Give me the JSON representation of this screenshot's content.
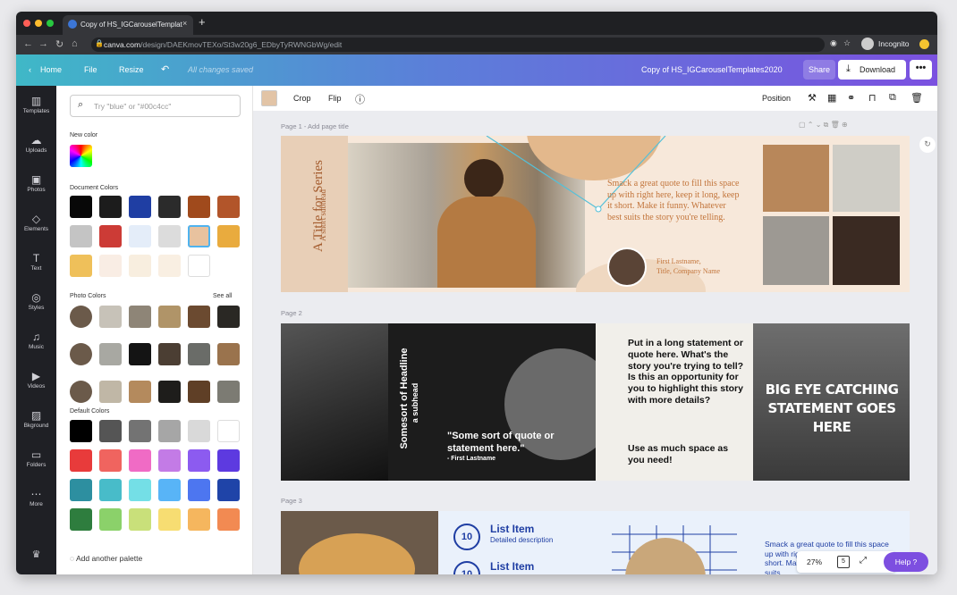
{
  "browser": {
    "tab_title": "Copy of HS_IGCarouselTemplat",
    "tab_close": "×",
    "new_tab": "+",
    "url_host": "canva.com",
    "url_path": "/design/DAEKmovTEXo/St3w20g6_EDbyTyRWNGbWg/edit",
    "profile": "Incognito"
  },
  "header": {
    "home": "Home",
    "file": "File",
    "resize": "Resize",
    "saved": "All changes saved",
    "doc_title": "Copy of HS_IGCarouselTemplates2020",
    "share": "Share",
    "download": "Download",
    "more": "•••"
  },
  "rail": [
    {
      "label": "Templates",
      "icon": "▥"
    },
    {
      "label": "Uploads",
      "icon": "☁"
    },
    {
      "label": "Photos",
      "icon": "▣"
    },
    {
      "label": "Elements",
      "icon": "◇"
    },
    {
      "label": "Text",
      "icon": "T"
    },
    {
      "label": "Styles",
      "icon": "◎"
    },
    {
      "label": "Music",
      "icon": "♫"
    },
    {
      "label": "Videos",
      "icon": "▶"
    },
    {
      "label": "Bkground",
      "icon": "▨"
    },
    {
      "label": "Folders",
      "icon": "▭"
    },
    {
      "label": "More",
      "icon": "⋯"
    }
  ],
  "panel": {
    "search_placeholder": "Try \"blue\" or \"#00c4cc\"",
    "new_color": "New color",
    "document_colors": "Document Colors",
    "doc_swatches": [
      "#080808",
      "#1c1c1c",
      "#1f3ea3",
      "#2b2b2b",
      "#a04a1c",
      "#b2552a",
      "#c4c4c4",
      "#cc3b36",
      "#e4edf9",
      "#dcdcdc",
      "#e8c29f",
      "#e9ab3e",
      "#efc05a",
      "#f9ede4",
      "#f8eedf",
      "#f9efe2",
      "#ffffff"
    ],
    "photo_colors": "Photo Colors",
    "see_all": "See all",
    "photo_rows": [
      [
        "#c7c2b8",
        "#8e8577",
        "#b09468",
        "#6b4a30",
        "#2a2824"
      ],
      [
        "#a8a8a2",
        "#141414",
        "#4b3e33",
        "#6a6c68",
        "#9a734d"
      ],
      [
        "#c0b7a6",
        "#b48a5d",
        "#1e1d1b",
        "#5f3f26",
        "#7c7b73"
      ]
    ],
    "default_colors": "Default Colors",
    "default_rows": [
      [
        "#000000",
        "#555555",
        "#737373",
        "#a6a6a6",
        "#d9d9d9",
        "#ffffff"
      ],
      [
        "#e83b3b",
        "#f0645f",
        "#f06bc5",
        "#c37be6",
        "#8c5bf0",
        "#5d3ae0"
      ],
      [
        "#2d8fa0",
        "#48bcc9",
        "#74dfe6",
        "#58b4f7",
        "#4d76f0",
        "#1f44a8"
      ],
      [
        "#2e7d3e",
        "#8bd16a",
        "#c9e07a",
        "#f7dd72",
        "#f5b65e",
        "#f28a52"
      ]
    ],
    "add_palette": "Add another palette"
  },
  "toolbar": {
    "crop": "Crop",
    "flip": "Flip",
    "info": "ⓘ",
    "position": "Position",
    "swatch": "#e2c4a6"
  },
  "pages": {
    "p1_label": "Page 1 - Add page title",
    "p1": {
      "title": "A Title for Series",
      "subhead": "A short subhead",
      "quote": "Smack a great quote to fill this space up with right here, keep it long, keep it short. Make it funny. Whatever best suits the story you're telling.",
      "name": "First Lastname,",
      "company": "Title, Company Name"
    },
    "p2_label": "Page 2",
    "p2": {
      "vertical_title": "Somesort of Headline",
      "vertical_sub": "a subhead",
      "quote": "\"Some sort of quote or statement here.\"",
      "by": "- First Lastname",
      "long": "Put in a long statement or quote here. What's the story you're trying to tell? Is this an opportunity for you to highlight this story with more details?",
      "long2": "Use as much space as you need!",
      "big": "BIG EYE CATCHING STATEMENT GOES HERE"
    },
    "p3_label": "Page 3",
    "p3": {
      "num": "10",
      "item": "List Item",
      "desc": "Detailed description",
      "quote": "Smack a great quote to fill this space up with right here, keep it long, keep it short. Make it funny. Whatever best suits"
    }
  },
  "zoom": {
    "value": "27%",
    "pages": "5"
  },
  "help": "Help ?"
}
